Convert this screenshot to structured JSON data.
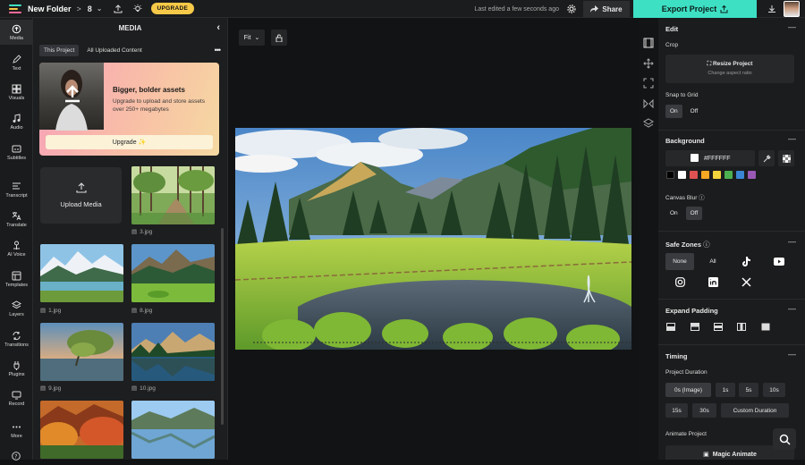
{
  "topbar": {
    "folder_name": "New Folder",
    "separator": ">",
    "project_count": "8",
    "upgrade_label": "UPGRADE",
    "last_edited": "Last edited a few seconds ago",
    "share_label": "Share",
    "export_label": "Export Project"
  },
  "nav": [
    {
      "label": "Media",
      "icon": "media-icon"
    },
    {
      "label": "Text",
      "icon": "text-icon"
    },
    {
      "label": "Visuals",
      "icon": "visuals-icon"
    },
    {
      "label": "Audio",
      "icon": "audio-icon"
    },
    {
      "label": "Subtitles",
      "icon": "subtitles-icon"
    },
    {
      "label": "Transcript",
      "icon": "transcript-icon"
    },
    {
      "label": "Translate",
      "icon": "translate-icon"
    },
    {
      "label": "AI Voice",
      "icon": "ai-voice-icon"
    },
    {
      "label": "Templates",
      "icon": "templates-icon"
    },
    {
      "label": "Layers",
      "icon": "layers-icon"
    },
    {
      "label": "Transitions",
      "icon": "transitions-icon"
    },
    {
      "label": "Plugins",
      "icon": "plugins-icon"
    },
    {
      "label": "Record",
      "icon": "record-icon"
    },
    {
      "label": "More",
      "icon": "more-icon"
    }
  ],
  "media": {
    "title": "MEDIA",
    "tabs": [
      "This Project",
      "All Uploaded Content"
    ],
    "promo_title": "Bigger, bolder assets",
    "promo_text": "Upgrade to upload and store assets over 250+ megabytes",
    "promo_button": "Upgrade ✨",
    "upload_label": "Upload Media",
    "files": [
      "3.jpg",
      "1.jpg",
      "8.jpg",
      "9.jpg",
      "10.jpg"
    ]
  },
  "canvas": {
    "fit_label": "Fit"
  },
  "edit": {
    "title": "Edit",
    "crop_label": "Crop",
    "resize_title": "Resize Project",
    "resize_sub": "Change aspect ratio",
    "snap_label": "Snap to Grid",
    "snap_on": "On",
    "snap_off": "Off"
  },
  "background": {
    "title": "Background",
    "color_value": "#FFFFFF",
    "swatches": [
      "#000000",
      "#ffffff",
      "#e05252",
      "#f5a623",
      "#f2d43c",
      "#4cb050",
      "#3a86d4",
      "#9b59b6"
    ],
    "blur_label": "Canvas Blur",
    "blur_on": "On",
    "blur_off": "Off"
  },
  "safe_zones": {
    "title": "Safe Zones",
    "none_label": "None",
    "all_label": "All"
  },
  "padding": {
    "title": "Expand Padding"
  },
  "timing": {
    "title": "Timing",
    "duration_label": "Project Duration",
    "durations": [
      "0s (Image)",
      "1s",
      "5s",
      "10s",
      "15s",
      "30s",
      "Custom Duration"
    ],
    "animate_label": "Animate Project",
    "magic_label": "Magic Animate"
  },
  "colors": {
    "accent": "#3ee0c4",
    "upgrade": "#f7c948"
  }
}
